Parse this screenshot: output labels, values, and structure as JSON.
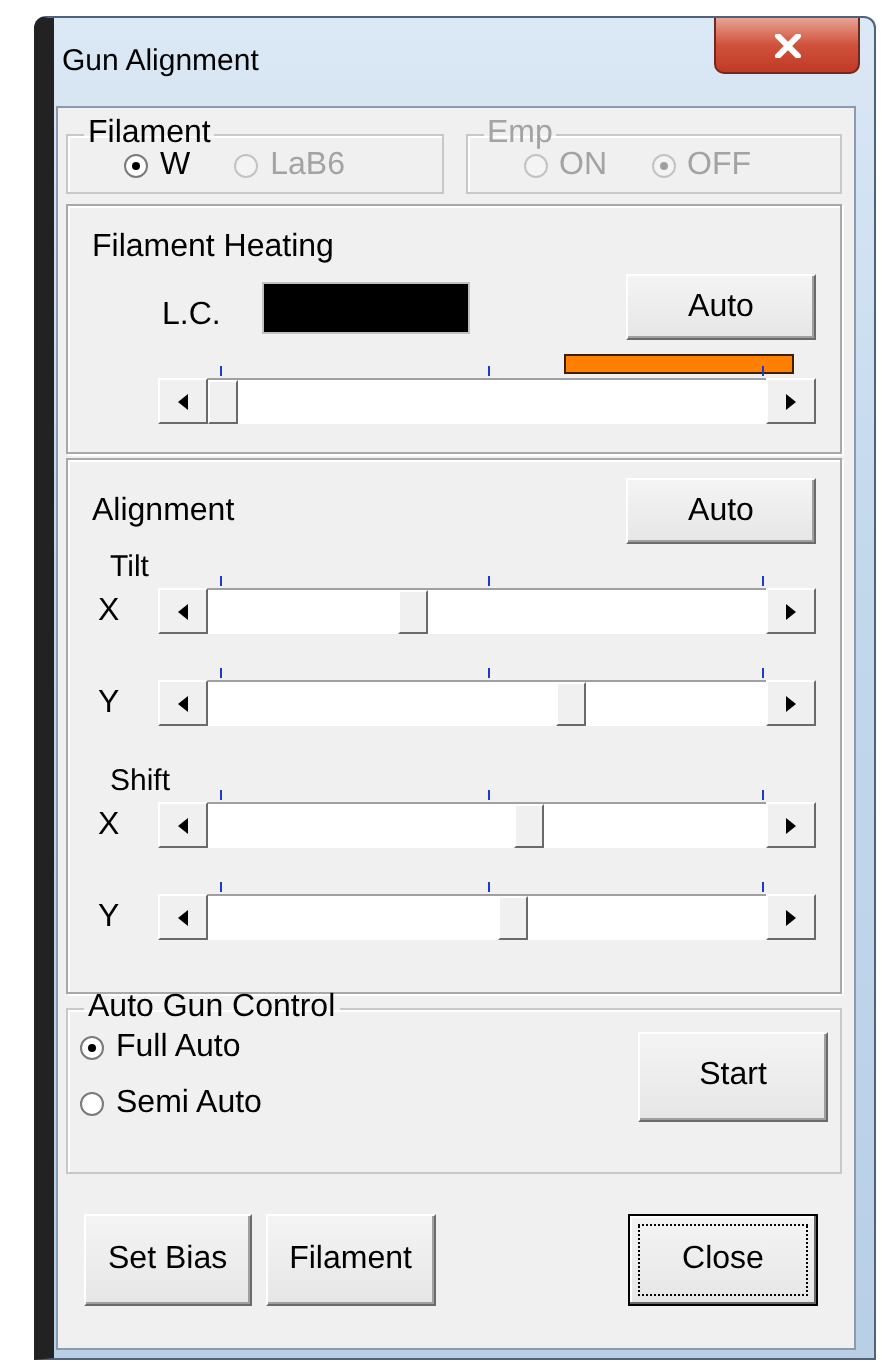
{
  "window": {
    "title": "Gun Alignment"
  },
  "filament": {
    "label": "Filament",
    "disabled": false,
    "options": [
      {
        "label": "W",
        "selected": true,
        "disabled": false
      },
      {
        "label": "LaB6",
        "selected": false,
        "disabled": true
      }
    ]
  },
  "emp": {
    "label": "Emp",
    "disabled": true,
    "options": [
      {
        "label": "ON",
        "selected": false,
        "disabled": true
      },
      {
        "label": "OFF",
        "selected": true,
        "disabled": true
      }
    ]
  },
  "filament_heating": {
    "title": "Filament Heating",
    "lc_label": "L.C.",
    "auto_button": "Auto",
    "slider": {
      "level": 0.0
    }
  },
  "alignment": {
    "title": "Alignment",
    "auto_button": "Auto",
    "groups": [
      {
        "label": "Tilt",
        "sliders": [
          {
            "axis": "X",
            "level": 0.36
          },
          {
            "axis": "Y",
            "level": 0.66
          }
        ]
      },
      {
        "label": "Shift",
        "sliders": [
          {
            "axis": "X",
            "level": 0.58
          },
          {
            "axis": "Y",
            "level": 0.55
          }
        ]
      }
    ]
  },
  "auto_gun_control": {
    "label": "Auto Gun Control",
    "options": [
      {
        "label": "Full Auto",
        "selected": true
      },
      {
        "label": "Semi Auto",
        "selected": false
      }
    ],
    "start_button": "Start"
  },
  "buttons": [
    {
      "label": "Set Bias",
      "focused": false
    },
    {
      "label": "Filament",
      "focused": false
    },
    {
      "label": "Close",
      "focused": true
    }
  ]
}
